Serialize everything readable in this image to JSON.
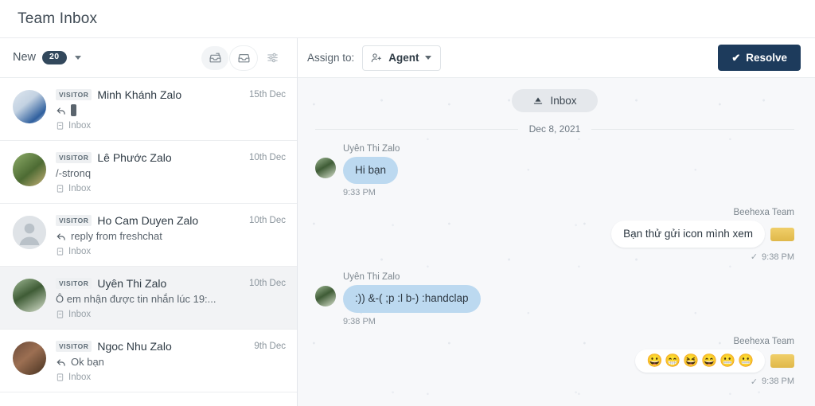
{
  "app": {
    "title": "Team Inbox"
  },
  "list_header": {
    "filter_label": "New",
    "count": "20",
    "icons": {
      "tray_all": "inbox-tray-icon",
      "tray_active": "inbox-tray-active-icon",
      "filter": "filter-sliders-icon",
      "chevron": "chevron-down-icon"
    }
  },
  "conversations": [
    {
      "badge": "VISITOR",
      "name": "Minh Khánh Zalo",
      "date": "15th Dec",
      "preview": "",
      "has_reply_icon": true,
      "has_attachment": true,
      "folder": "Inbox",
      "selected": false
    },
    {
      "badge": "VISITOR",
      "name": "Lê Phước Zalo",
      "date": "10th Dec",
      "preview": "/-stronq",
      "has_reply_icon": false,
      "has_attachment": false,
      "folder": "Inbox",
      "selected": false
    },
    {
      "badge": "VISITOR",
      "name": "Ho Cam Duyen Zalo",
      "date": "10th Dec",
      "preview": "reply from freshchat",
      "has_reply_icon": true,
      "has_attachment": false,
      "folder": "Inbox",
      "selected": false
    },
    {
      "badge": "VISITOR",
      "name": "Uyên Thi Zalo",
      "date": "10th Dec",
      "preview": "Ô em nhận được tin nhắn lúc 19:...",
      "has_reply_icon": false,
      "has_attachment": false,
      "folder": "Inbox",
      "selected": true
    },
    {
      "badge": "VISITOR",
      "name": "Ngoc Nhu Zalo",
      "date": "9th Dec",
      "preview": "Ok bạn",
      "has_reply_icon": true,
      "has_attachment": false,
      "folder": "Inbox",
      "selected": false
    }
  ],
  "chat_header": {
    "assign_label": "Assign to:",
    "assignee": "Agent",
    "resolve_label": "Resolve",
    "check_glyph": "✔"
  },
  "chat": {
    "channel_pill": "Inbox",
    "date_divider": "Dec 8, 2021",
    "messages": [
      {
        "direction": "incoming",
        "sender": "Uyên Thi Zalo",
        "text": "Hi bạn",
        "time": "9:33 PM",
        "delivered": false,
        "emojis": []
      },
      {
        "direction": "outgoing",
        "sender": "Beehexa Team",
        "text": "Bạn thử gửi icon mình xem",
        "time": "9:38 PM",
        "delivered": true,
        "emojis": []
      },
      {
        "direction": "incoming",
        "sender": "Uyên Thi Zalo",
        "text": ":)) &-( ;p :l b-) :handclap",
        "time": "9:38 PM",
        "delivered": false,
        "emojis": []
      },
      {
        "direction": "outgoing",
        "sender": "Beehexa Team",
        "text": "",
        "time": "9:38 PM",
        "delivered": true,
        "emojis": [
          "😀",
          "😁",
          "😆",
          "😄",
          "😬",
          "😬"
        ]
      }
    ]
  },
  "colors": {
    "accent_dark": "#1d3b5c",
    "badge_dark": "#32485c",
    "bubble_in": "#bcd9f0",
    "bubble_out": "#ffffff",
    "chat_bg": "#f7f8fa",
    "selected_row": "#f2f3f5"
  }
}
